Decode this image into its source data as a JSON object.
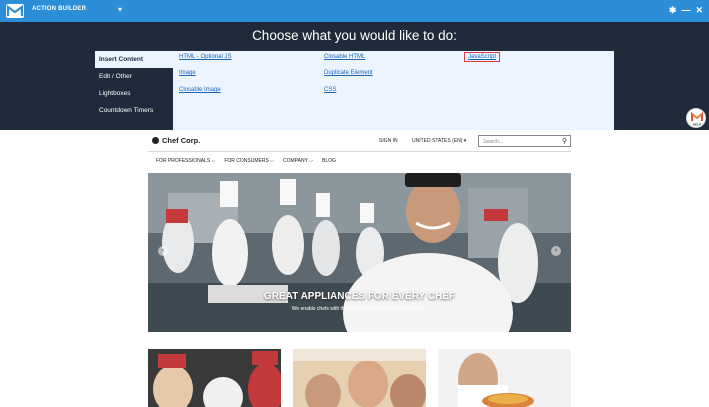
{
  "topbar": {
    "title": "ACTION BUILDER",
    "caret": "▾",
    "pin": "✱",
    "minimize": "—",
    "close": "✕"
  },
  "panel": {
    "heading": "Choose what you would like to do:",
    "menu": [
      {
        "label": "Insert Content",
        "active": true
      },
      {
        "label": "Edit / Other"
      },
      {
        "label": "Lightboxes"
      },
      {
        "label": "Countdown Timers"
      }
    ],
    "links": {
      "html_optional_js": "HTML - Optional JS",
      "closable_html": "Closable HTML",
      "javascript": "JavaScript",
      "image": "Image",
      "duplicate_element": "Duplicate Element",
      "closable_image": "Closable Image",
      "css": "CSS"
    },
    "help_label": "HELP"
  },
  "site": {
    "brand": "Chef Corp.",
    "sign_in": "SIGN IN",
    "locale": "UNITED STATES (EN)  ▾",
    "search_placeholder": "Search...",
    "nav": [
      "FOR PROFESSIONALS ⌵",
      "FOR CONSUMERS ⌵",
      "COMPANY ⌵",
      "BLOG"
    ],
    "hero_title": "GREAT APPLIANCES FOR EVERY CHEF",
    "hero_subtitle": "We enable chefs with the best tools to prepare perfect meals."
  }
}
